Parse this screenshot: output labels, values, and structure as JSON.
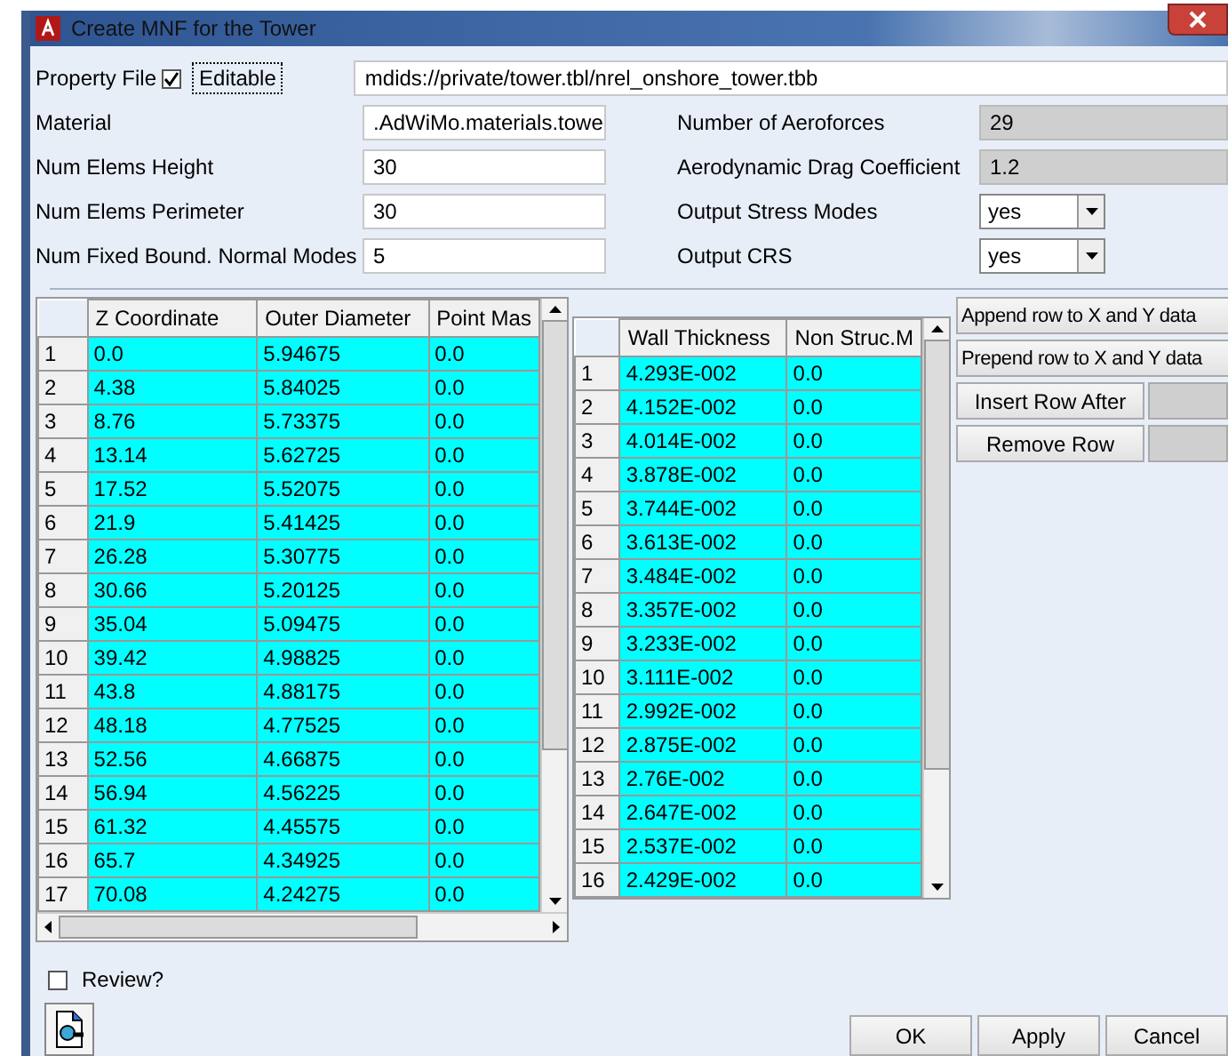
{
  "window": {
    "title": "Create MNF for the Tower"
  },
  "property_file": {
    "label": "Property File",
    "checked": true,
    "editable_label": "Editable",
    "value": "mdids://private/tower.tbl/nrel_onshore_tower.tbb"
  },
  "left_fields": [
    {
      "label": "Material",
      "value": ".AdWiMo.materials.towe"
    },
    {
      "label": "Num Elems Height",
      "value": "30"
    },
    {
      "label": "Num Elems Perimeter",
      "value": "30"
    },
    {
      "label": "Num Fixed Bound. Normal Modes",
      "value": "5"
    }
  ],
  "right_fields": [
    {
      "label": "Number of Aeroforces",
      "kind": "readonly",
      "value": "29"
    },
    {
      "label": "Aerodynamic Drag Coefficient",
      "kind": "readonly",
      "value": "1.2"
    },
    {
      "label": "Output Stress Modes",
      "kind": "dropdown",
      "value": "yes"
    },
    {
      "label": "Output CRS",
      "kind": "dropdown",
      "value": "yes"
    }
  ],
  "table_left": {
    "columns": [
      "Z Coordinate",
      "Outer Diameter",
      "Point Mas"
    ],
    "rows": [
      {
        "index": "1",
        "cells": [
          "0.0",
          "5.94675",
          "0.0"
        ]
      },
      {
        "index": "2",
        "cells": [
          "4.38",
          "5.84025",
          "0.0"
        ]
      },
      {
        "index": "3",
        "cells": [
          "8.76",
          "5.73375",
          "0.0"
        ]
      },
      {
        "index": "4",
        "cells": [
          "13.14",
          "5.62725",
          "0.0"
        ]
      },
      {
        "index": "5",
        "cells": [
          "17.52",
          "5.52075",
          "0.0"
        ]
      },
      {
        "index": "6",
        "cells": [
          "21.9",
          "5.41425",
          "0.0"
        ]
      },
      {
        "index": "7",
        "cells": [
          "26.28",
          "5.30775",
          "0.0"
        ]
      },
      {
        "index": "8",
        "cells": [
          "30.66",
          "5.20125",
          "0.0"
        ]
      },
      {
        "index": "9",
        "cells": [
          "35.04",
          "5.09475",
          "0.0"
        ]
      },
      {
        "index": "10",
        "cells": [
          "39.42",
          "4.98825",
          "0.0"
        ]
      },
      {
        "index": "11",
        "cells": [
          "43.8",
          "4.88175",
          "0.0"
        ]
      },
      {
        "index": "12",
        "cells": [
          "48.18",
          "4.77525",
          "0.0"
        ]
      },
      {
        "index": "13",
        "cells": [
          "52.56",
          "4.66875",
          "0.0"
        ]
      },
      {
        "index": "14",
        "cells": [
          "56.94",
          "4.56225",
          "0.0"
        ]
      },
      {
        "index": "15",
        "cells": [
          "61.32",
          "4.45575",
          "0.0"
        ]
      },
      {
        "index": "16",
        "cells": [
          "65.7",
          "4.34925",
          "0.0"
        ]
      },
      {
        "index": "17",
        "cells": [
          "70.08",
          "4.24275",
          "0.0"
        ]
      }
    ]
  },
  "table_right": {
    "columns": [
      "Wall Thickness",
      "Non Struc.M"
    ],
    "rows": [
      {
        "index": "1",
        "cells": [
          "4.293E-002",
          "0.0"
        ]
      },
      {
        "index": "2",
        "cells": [
          "4.152E-002",
          "0.0"
        ]
      },
      {
        "index": "3",
        "cells": [
          "4.014E-002",
          "0.0"
        ]
      },
      {
        "index": "4",
        "cells": [
          "3.878E-002",
          "0.0"
        ]
      },
      {
        "index": "5",
        "cells": [
          "3.744E-002",
          "0.0"
        ]
      },
      {
        "index": "6",
        "cells": [
          "3.613E-002",
          "0.0"
        ]
      },
      {
        "index": "7",
        "cells": [
          "3.484E-002",
          "0.0"
        ]
      },
      {
        "index": "8",
        "cells": [
          "3.357E-002",
          "0.0"
        ]
      },
      {
        "index": "9",
        "cells": [
          "3.233E-002",
          "0.0"
        ]
      },
      {
        "index": "10",
        "cells": [
          "3.111E-002",
          "0.0"
        ]
      },
      {
        "index": "11",
        "cells": [
          "2.992E-002",
          "0.0"
        ]
      },
      {
        "index": "12",
        "cells": [
          "2.875E-002",
          "0.0"
        ]
      },
      {
        "index": "13",
        "cells": [
          "2.76E-002",
          "0.0"
        ]
      },
      {
        "index": "14",
        "cells": [
          "2.647E-002",
          "0.0"
        ]
      },
      {
        "index": "15",
        "cells": [
          "2.537E-002",
          "0.0"
        ]
      },
      {
        "index": "16",
        "cells": [
          "2.429E-002",
          "0.0"
        ]
      }
    ]
  },
  "row_buttons": [
    {
      "label": "Append row to X and Y data",
      "kind": "wide"
    },
    {
      "label": "Prepend row to X and Y data",
      "kind": "wide"
    },
    {
      "label": "Insert Row After",
      "kind": "with-field"
    },
    {
      "label": "Remove Row",
      "kind": "with-field"
    }
  ],
  "review": {
    "label": "Review?",
    "checked": false
  },
  "buttons": [
    "OK",
    "Apply",
    "Cancel"
  ]
}
